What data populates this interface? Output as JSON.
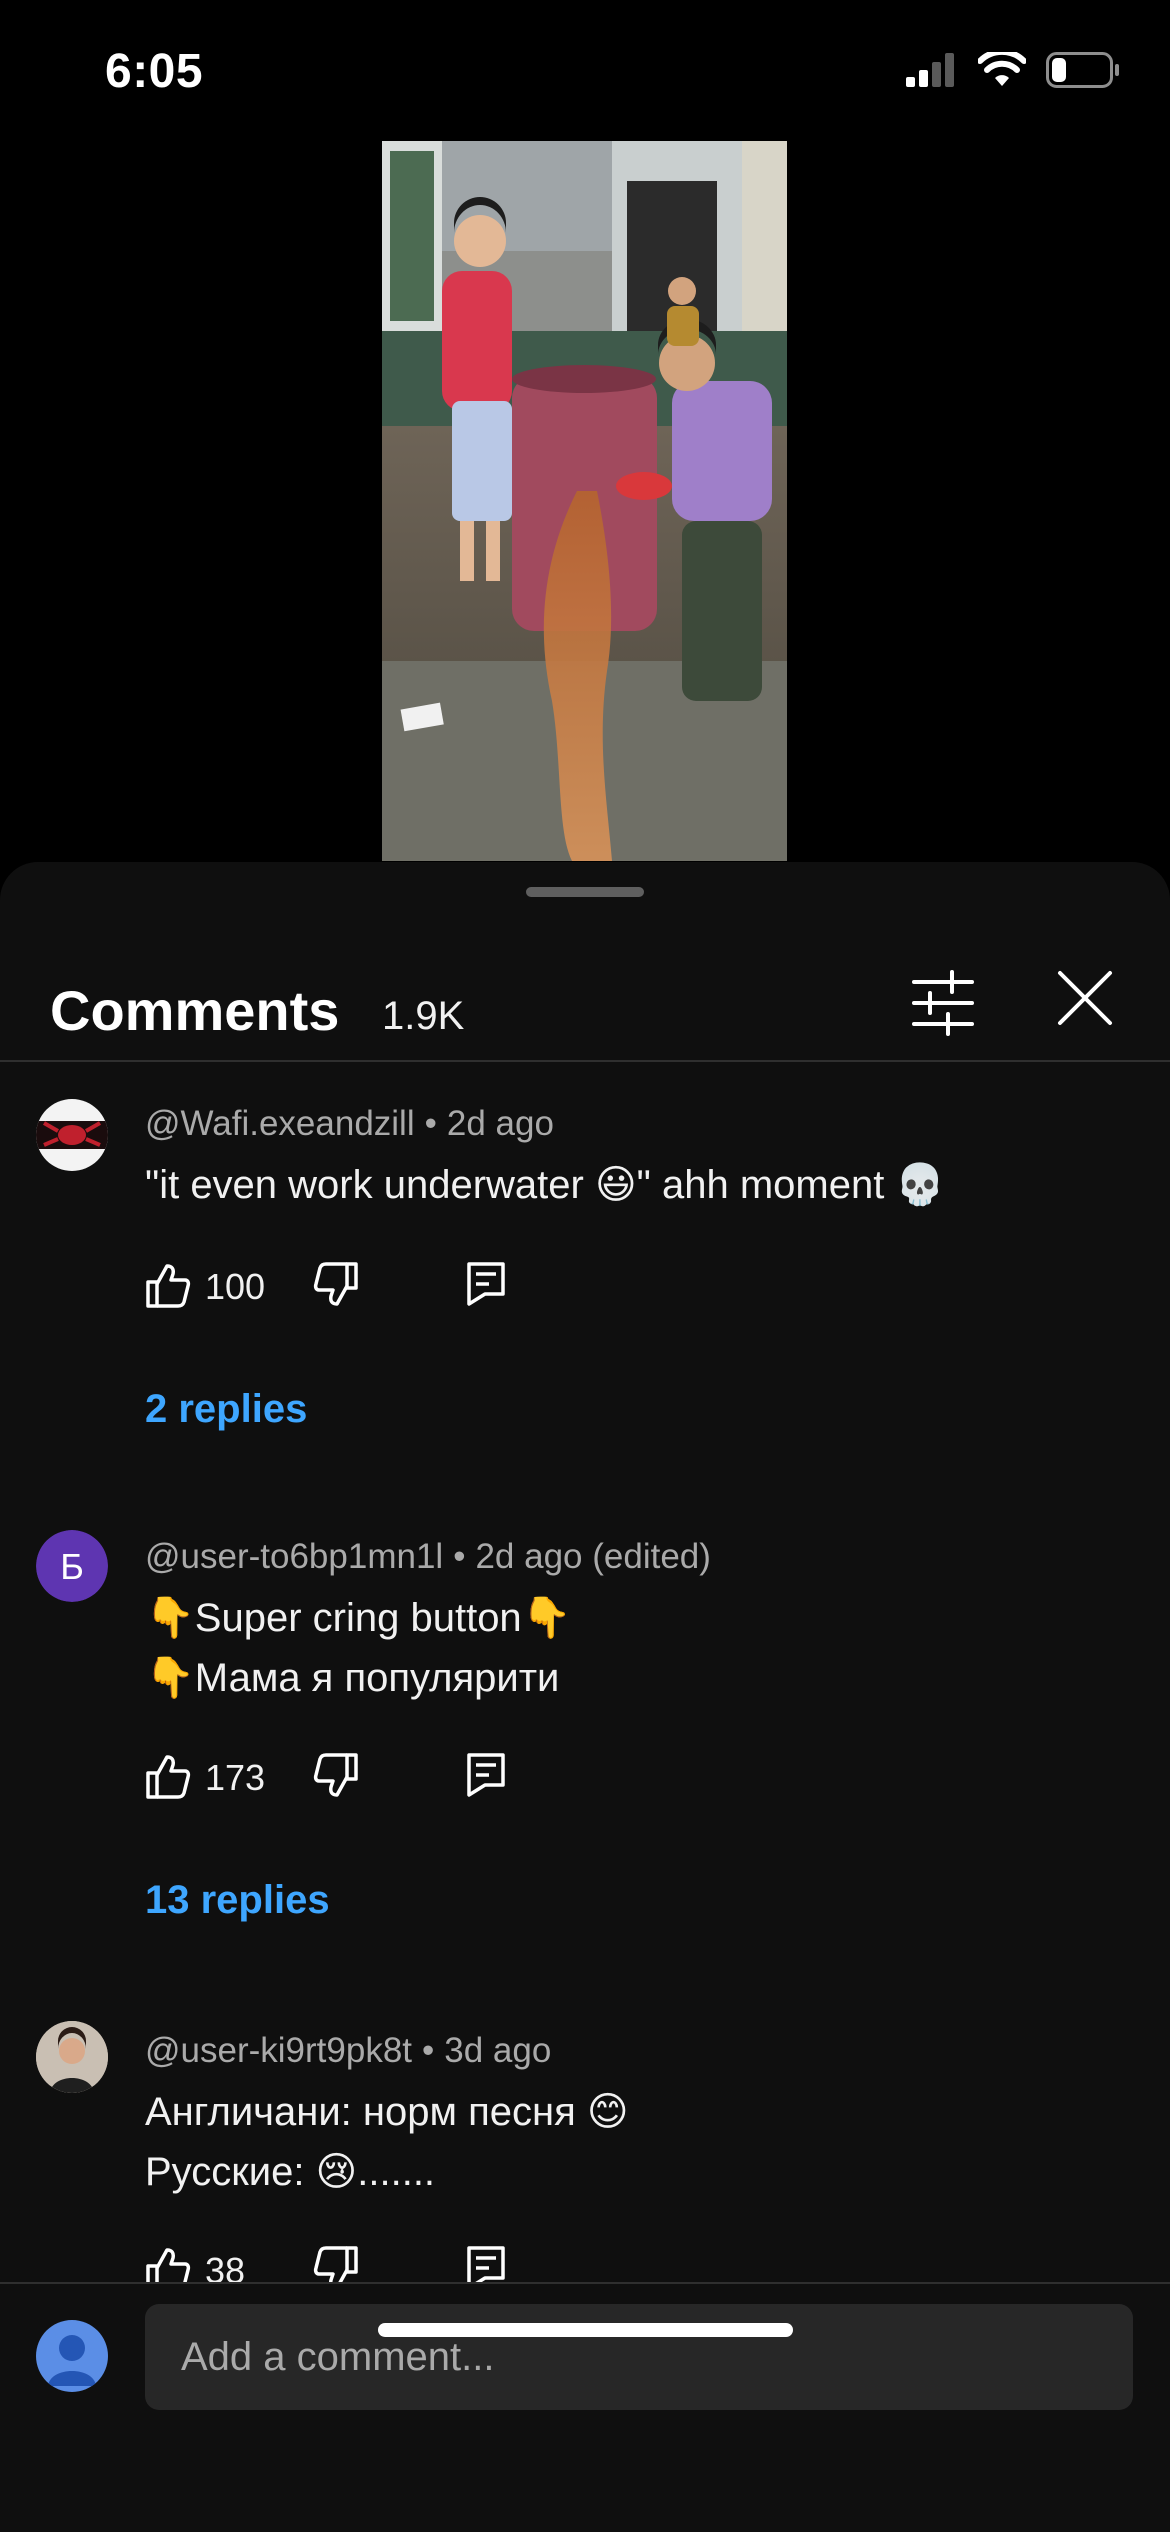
{
  "status_bar": {
    "time": "6:05",
    "battery_level": 0.25
  },
  "sheet": {
    "title": "Comments",
    "count": "1.9K",
    "filter_icon": "sliders-icon",
    "close_icon": "close-icon"
  },
  "comments": [
    {
      "author": "@Wafi.exeandzill",
      "time": "2d ago",
      "lines": [
        "\"it even work underwater 😃\" ahh moment 💀"
      ],
      "likes": "100",
      "replies": "2 replies"
    },
    {
      "author": "@user-to6bp1mn1l",
      "time": "2d ago (edited)",
      "avatar_letter": "Б",
      "avatar_color": "#5e35b1",
      "lines": [
        "👇Super cring button👇",
        "👇Мама я популярити"
      ],
      "likes": "173",
      "replies": "13 replies"
    },
    {
      "author": "@user-ki9rt9pk8t",
      "time": "3d ago",
      "lines": [
        "Англичани: норм песня 😊",
        "Русские: 😢......."
      ],
      "likes": "38"
    }
  ],
  "composer": {
    "placeholder": "Add a comment..."
  },
  "colors": {
    "link": "#3ea6ff",
    "sheet_bg": "#0f0f0f",
    "input_bg": "#272727"
  }
}
